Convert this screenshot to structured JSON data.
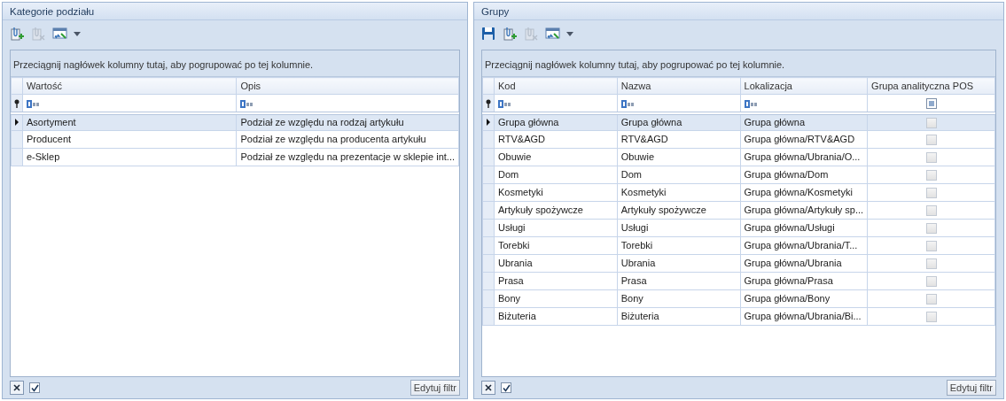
{
  "panels": [
    {
      "title": "Kategorie podziału",
      "toolbar": [
        {
          "kind": "add",
          "disabled": false
        },
        {
          "kind": "delete",
          "disabled": true
        },
        {
          "kind": "list",
          "disabled": false
        }
      ],
      "group_hint": "Przeciągnij nagłówek kolumny tutaj, aby pogrupować po tej kolumnie.",
      "columns": [
        {
          "label": "Wartość",
          "kind": "text"
        },
        {
          "label": "Opis",
          "kind": "text"
        }
      ],
      "rows": [
        {
          "selected": true,
          "cells": [
            "Asortyment",
            "Podział ze względu na rodzaj artykułu"
          ]
        },
        {
          "selected": false,
          "cells": [
            "Producent",
            "Podział ze względu na producenta artykułu"
          ]
        },
        {
          "selected": false,
          "cells": [
            "e-Sklep",
            "Podział ze względu na prezentacje w sklepie int..."
          ]
        }
      ],
      "footer": {
        "filter_enabled": true,
        "edit_filter_button": "Edytuj filtr"
      }
    },
    {
      "title": "Grupy",
      "toolbar": [
        {
          "kind": "save",
          "disabled": false
        },
        {
          "kind": "add",
          "disabled": false
        },
        {
          "kind": "delete",
          "disabled": true
        },
        {
          "kind": "list",
          "disabled": false
        }
      ],
      "group_hint": "Przeciągnij nagłówek kolumny tutaj, aby pogrupować po tej kolumnie.",
      "columns": [
        {
          "label": "Kod",
          "kind": "text"
        },
        {
          "label": "Nazwa",
          "kind": "text"
        },
        {
          "label": "Lokalizacja",
          "kind": "text"
        },
        {
          "label": "Grupa analityczna POS",
          "kind": "checkbox",
          "filter_indeterminate": true
        }
      ],
      "rows": [
        {
          "selected": true,
          "checked": false,
          "cells": [
            "Grupa główna",
            "Grupa główna",
            "Grupa główna"
          ]
        },
        {
          "selected": false,
          "checked": false,
          "cells": [
            "RTV&AGD",
            "RTV&AGD",
            "Grupa główna/RTV&AGD"
          ]
        },
        {
          "selected": false,
          "checked": false,
          "cells": [
            "Obuwie",
            "Obuwie",
            "Grupa główna/Ubrania/O..."
          ]
        },
        {
          "selected": false,
          "checked": false,
          "cells": [
            "Dom",
            "Dom",
            "Grupa główna/Dom"
          ]
        },
        {
          "selected": false,
          "checked": false,
          "cells": [
            "Kosmetyki",
            "Kosmetyki",
            "Grupa główna/Kosmetyki"
          ]
        },
        {
          "selected": false,
          "checked": false,
          "cells": [
            "Artykuły spożywcze",
            "Artykuły spożywcze",
            "Grupa główna/Artykuły sp..."
          ]
        },
        {
          "selected": false,
          "checked": false,
          "cells": [
            "Usługi",
            "Usługi",
            "Grupa główna/Usługi"
          ]
        },
        {
          "selected": false,
          "checked": false,
          "cells": [
            "Torebki",
            "Torebki",
            "Grupa główna/Ubrania/T..."
          ]
        },
        {
          "selected": false,
          "checked": false,
          "cells": [
            "Ubrania",
            "Ubrania",
            "Grupa główna/Ubrania"
          ]
        },
        {
          "selected": false,
          "checked": false,
          "cells": [
            "Prasa",
            "Prasa",
            "Grupa główna/Prasa"
          ]
        },
        {
          "selected": false,
          "checked": false,
          "cells": [
            "Bony",
            "Bony",
            "Grupa główna/Bony"
          ]
        },
        {
          "selected": false,
          "checked": false,
          "cells": [
            "Biżuteria",
            "Biżuteria",
            "Grupa główna/Ubrania/Bi..."
          ]
        }
      ],
      "footer": {
        "filter_enabled": true,
        "edit_filter_button": "Edytuj filtr"
      }
    }
  ]
}
